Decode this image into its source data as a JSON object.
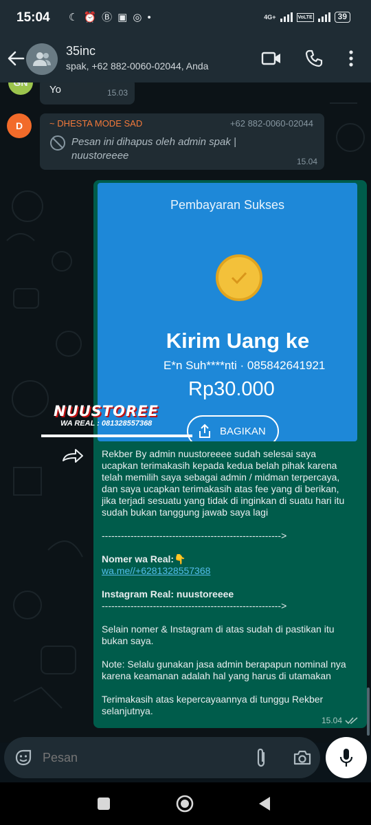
{
  "status_bar": {
    "time": "15:04",
    "network_label_top": "4G+",
    "network_label_2": "Vo\nLTE",
    "battery": "39"
  },
  "header": {
    "title": "35inc",
    "subtitle": "spak, +62 882-0060-02044, Anda"
  },
  "messages": [
    {
      "avatar_initials": "GN",
      "avatar_color": "#9cc44d",
      "text": "Yo",
      "time": "15.03"
    },
    {
      "avatar_initials": "D",
      "avatar_color": "#f26b2a",
      "sender_name": "~ DHESTA MODE SAD",
      "sender_color": "#f47a3b",
      "sender_phone": "+62 882-0060-02044",
      "deleted_text": "Pesan ini dihapus oleh admin spak | nuustoreeee",
      "time": "15.04"
    }
  ],
  "outgoing": {
    "image": {
      "title": "Pembayaran Sukses",
      "heading": "Kirim Uang ke",
      "recipient": "E*n Suh****nti · 085842641921",
      "amount": "Rp30.000",
      "share_label": "BAGIKAN"
    },
    "logo": {
      "name": "NUUSTOREE",
      "sub": "WA REAL : 081328557368"
    },
    "caption": {
      "p1": "Rekber By admin nuustoreeee sudah selesai saya ucapkan terimakasih kepada kedua belah pihak karena telah memilih saya sebagai admin / midman terpercaya, dan saya ucapkan terimakasih atas fee yang di berikan, jika terjadi sesuatu yang tidak di inginkan di suatu hari itu sudah bukan tanggung jawab saya lagi",
      "divider1": "-------------------------------------------------------->",
      "wa_label": "Nomer wa Real:",
      "wa_emoji": "👇",
      "wa_link": "wa.me//+6281328557368",
      "ig_label": "Instagram Real: nuustoreeee",
      "divider2": "-------------------------------------------------------->",
      "p2": "Selain nomer & Instagram di atas sudah di pastikan itu bukan saya.",
      "p3": "Note: Selalu gunakan jasa admin berapapun nominal nya karena keamanan adalah hal yang harus di utamakan",
      "p4": "Terimakasih atas kepercayaannya di tunggu Rekber selanjutnya."
    },
    "time": "15.04"
  },
  "input": {
    "placeholder": "Pesan"
  },
  "colors": {
    "outgoing_bubble": "#005c4b",
    "incoming_bubble": "#202c33",
    "header": "#1f2c34",
    "link": "#53bdeb"
  },
  "icons": [
    "back-arrow-icon",
    "group-avatar-icon",
    "video-call-icon",
    "phone-call-icon",
    "more-vert-icon",
    "block-icon",
    "check-circle-icon",
    "share-icon",
    "forward-icon",
    "double-check-icon",
    "sticker-icon",
    "attach-icon",
    "camera-icon",
    "mic-icon",
    "nav-recents-icon",
    "nav-home-icon",
    "nav-back-icon"
  ]
}
